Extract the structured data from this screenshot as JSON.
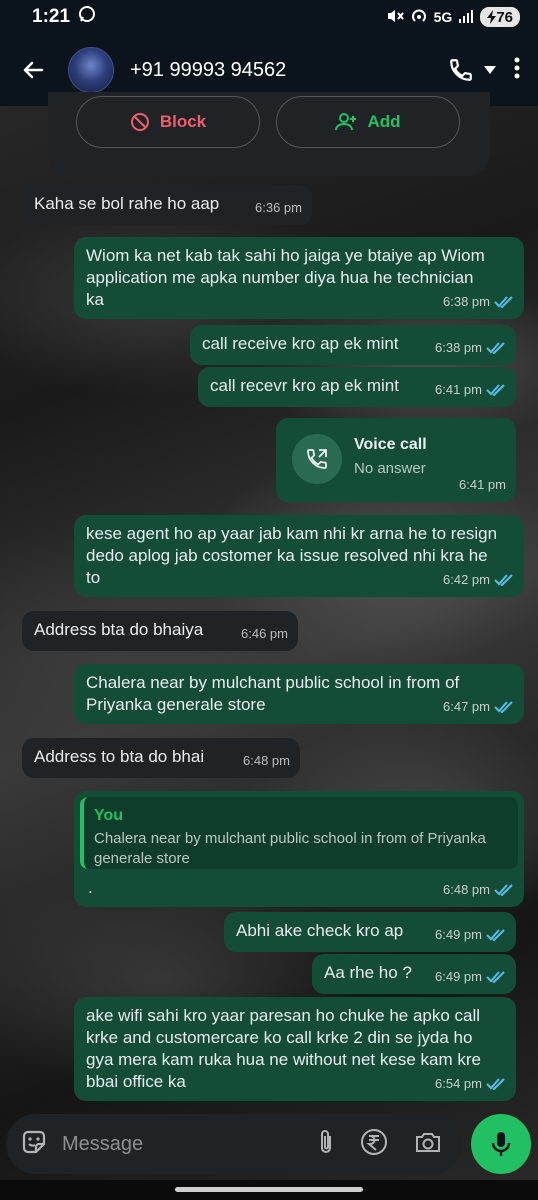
{
  "status_bar": {
    "time": "1:21",
    "network": "5G",
    "battery": "76"
  },
  "header": {
    "contact": "+91 99993 94562"
  },
  "card": {
    "block_label": "Block",
    "add_label": "Add"
  },
  "messages": [
    {
      "text": "Kaha se bol rahe ho aap",
      "time": "6:36 pm"
    },
    {
      "text": "Wiom ka net kab tak sahi ho jaiga ye btaiye ap Wiom application  me apka number diya hua he technician ka",
      "time": "6:38 pm"
    },
    {
      "text": "call receive kro ap ek mint",
      "time": "6:38 pm"
    },
    {
      "text": "call recevr kro ap ek mint",
      "time": "6:41 pm"
    },
    {
      "title": "Voice call",
      "subtitle": "No answer",
      "time": "6:41 pm"
    },
    {
      "text": "kese agent ho ap yaar jab kam nhi kr arna he to resign dedo aplog jab costomer ka issue resolved nhi kra he to",
      "time": "6:42 pm"
    },
    {
      "text": "Address bta do bhaiya",
      "time": "6:46 pm"
    },
    {
      "text": "Chalera near by mulchant public school in from of Priyanka generale store",
      "time": "6:47 pm"
    },
    {
      "text": "Address to bta do bhai",
      "time": "6:48 pm"
    },
    {
      "quote_author": "You",
      "quote_text": "Chalera near by mulchant public school in from of Priyanka generale store",
      "text": ".",
      "time": "6:48 pm"
    },
    {
      "text": "Abhi ake check kro ap",
      "time": "6:49 pm"
    },
    {
      "text": "Aa rhe ho ?",
      "time": "6:49 pm"
    },
    {
      "text": "ake wifi sahi kro yaar paresan ho chuke he apko call krke and customercare ko call krke 2 din se jyda ho gya mera kam ruka hua ne without net kese kam kre bbai office ka",
      "time": "6:54 pm"
    }
  ],
  "input": {
    "placeholder": "Message"
  },
  "icons": {
    "back": "arrow-left-icon",
    "call": "phone-icon",
    "menu": "more-vert-icon",
    "block": "block-icon",
    "add": "add-person-icon",
    "sticker": "sticker-icon",
    "attach": "paperclip-icon",
    "payment": "rupee-icon",
    "camera": "camera-icon",
    "mic": "mic-icon"
  },
  "colors": {
    "outgoing": "#144d37",
    "incoming": "#1f2326",
    "accent": "#21c063",
    "tick": "#53bdeb",
    "block": "#f15c6d"
  }
}
